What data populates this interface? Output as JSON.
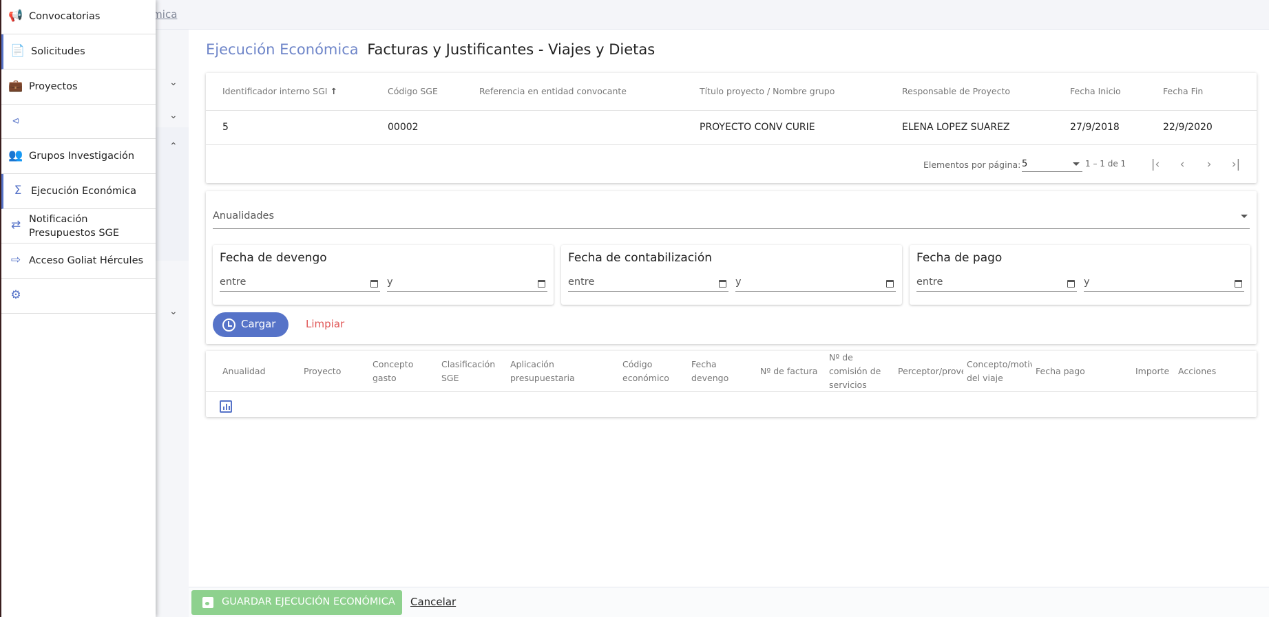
{
  "breadcrumb": "ómica",
  "page_title": {
    "section": "Ejecución Económica",
    "sub": "Facturas y Justificantes - Viajes y Dietas"
  },
  "projects_table": {
    "headers": [
      "Identificador interno SGI",
      "Código SGE",
      "Referencia en entidad convocante",
      "Título proyecto / Nombre grupo",
      "Responsable de Proyecto",
      "Fecha Inicio",
      "Fecha Fin"
    ],
    "sort_icon": "arrow-up-icon",
    "rows": [
      [
        "5",
        "00002",
        "",
        "PROYECTO CONV CURIE",
        "ELENA LOPEZ SUAREZ",
        "27/9/2018",
        "22/9/2020"
      ]
    ]
  },
  "pager": {
    "label": "Elementos por página:",
    "page_size": "5",
    "range": "1 – 1 de 1"
  },
  "filters": {
    "anualidades": "Anualidades",
    "groups": [
      {
        "title": "Fecha de devengo",
        "from": "entre",
        "to": "y"
      },
      {
        "title": "Fecha de contabilización",
        "from": "entre",
        "to": "y"
      },
      {
        "title": "Fecha de pago",
        "from": "entre",
        "to": "y"
      }
    ],
    "load_label": "Cargar",
    "clear_label": "Limpiar"
  },
  "results_table": {
    "headers": [
      "Anualidad",
      "Proyecto",
      "Concepto gasto",
      "Clasificación SGE",
      "Aplicación presupuestaria",
      "Código económico",
      "Fecha devengo",
      "Nº de factura",
      "Nº de comisión de servicios",
      "Perceptor/proveedor",
      "Concepto/motivo del viaje",
      "Fecha pago",
      "Importe",
      "Acciones"
    ]
  },
  "sidebar": {
    "items": [
      {
        "label": "Convocatorias",
        "icon": "megaphone-icon"
      },
      {
        "label": "Solicitudes",
        "icon": "document-icon"
      },
      {
        "label": "Proyectos",
        "icon": "briefcase-icon"
      },
      {
        "label": "",
        "icon": "share-icon"
      },
      {
        "label": "Grupos Investigación",
        "icon": "people-icon"
      },
      {
        "label": "Ejecución Económica",
        "icon": "sigma-icon"
      },
      {
        "label": "Notificación Presupuestos SGE",
        "icon": "swap-arrows-icon"
      },
      {
        "label": "Acceso Goliat Hércules",
        "icon": "exit-icon"
      },
      {
        "label": "",
        "icon": "gear-icon"
      }
    ]
  },
  "footer": {
    "save_label": "GUARDAR EJECUCIÓN ECONÓMICA",
    "cancel_label": "Cancelar"
  },
  "colors": {
    "accent": "#5673c8",
    "save": "#8ed18e",
    "clear": "#e05656"
  }
}
